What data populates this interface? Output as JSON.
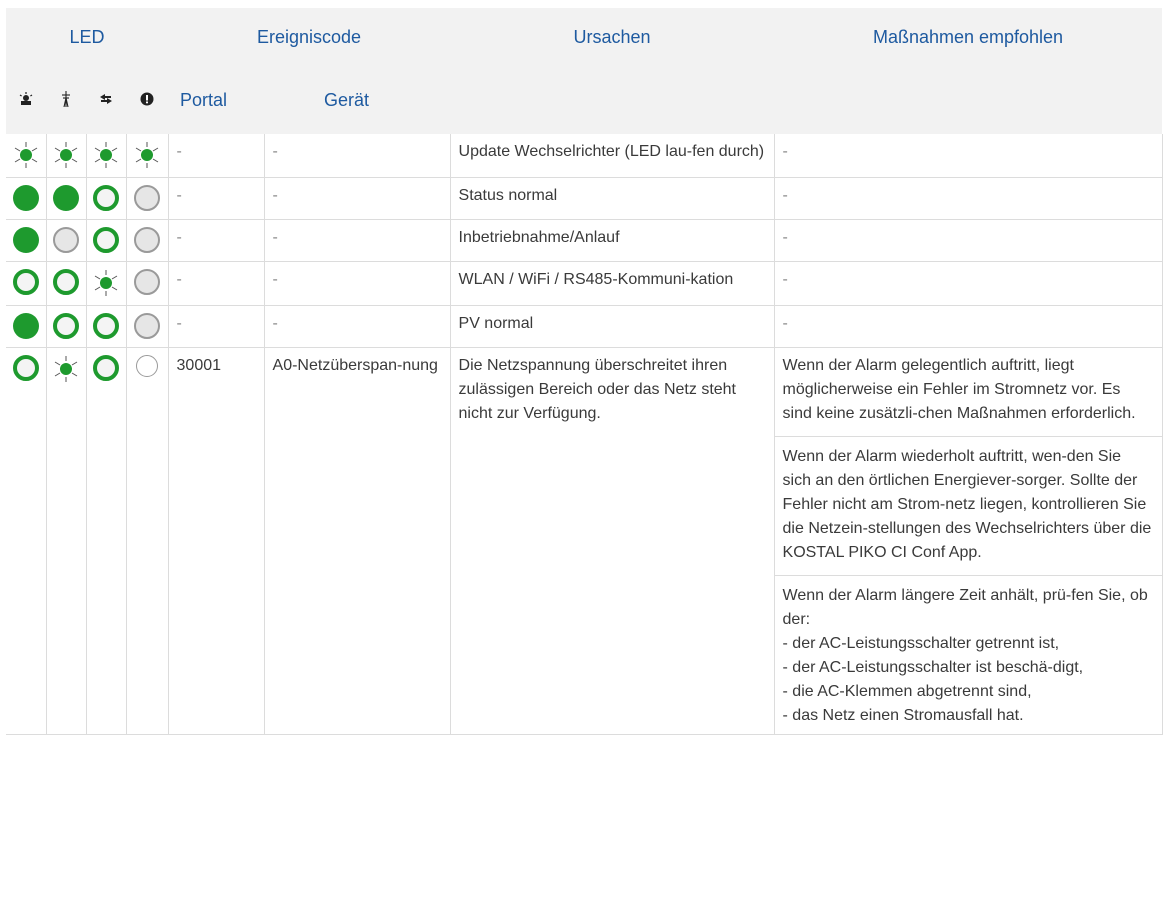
{
  "header": {
    "led": "LED",
    "ereigniscode": "Ereigniscode",
    "ursachen": "Ursachen",
    "massnahmen": "Maßnahmen empfohlen",
    "portal": "Portal",
    "geraet": "Gerät",
    "led_icons": [
      "pv-sun-icon",
      "grid-pylon-icon",
      "communication-icon",
      "warning-icon"
    ]
  },
  "rows": [
    {
      "leds": [
        "blink",
        "blink",
        "blink",
        "blink"
      ],
      "portal": "-",
      "geraet": "-",
      "ursache": "Update Wechselrichter (LED lau-fen durch)",
      "massnahmen": [
        "-"
      ]
    },
    {
      "leds": [
        "on",
        "on",
        "ring",
        "off"
      ],
      "portal": "-",
      "geraet": "-",
      "ursache": "Status normal",
      "massnahmen": [
        "-"
      ]
    },
    {
      "leds": [
        "on",
        "off",
        "ring",
        "off"
      ],
      "portal": "-",
      "geraet": "-",
      "ursache": "Inbetriebnahme/Anlauf",
      "massnahmen": [
        "-"
      ]
    },
    {
      "leds": [
        "ring",
        "ring",
        "blink",
        "off"
      ],
      "portal": "-",
      "geraet": "-",
      "ursache": "WLAN / WiFi / RS485-Kommuni-kation",
      "massnahmen": [
        "-"
      ]
    },
    {
      "leds": [
        "on",
        "ring",
        "ring",
        "off"
      ],
      "portal": "-",
      "geraet": "-",
      "ursache": "PV normal",
      "massnahmen": [
        "-"
      ]
    },
    {
      "leds": [
        "ring",
        "blink",
        "ring",
        "offw"
      ],
      "portal": "30001",
      "geraet": "A0-Netzüberspan-nung",
      "ursache": "Die Netzspannung überschreitet ihren zulässigen Bereich oder das Netz steht nicht zur Verfügung.",
      "massnahmen": [
        "Wenn der Alarm gelegentlich auftritt, liegt möglicherweise ein Fehler im Stromnetz vor. Es sind keine zusätzli-chen Maßnahmen erforderlich.",
        "Wenn der Alarm wiederholt auftritt, wen-den Sie sich an den örtlichen Energiever-sorger. Sollte der Fehler nicht am Strom-netz liegen, kontrollieren Sie die Netzein-stellungen des Wechselrichters über die KOSTAL PIKO CI Conf App.",
        "Wenn der Alarm längere Zeit anhält, prü-fen Sie, ob der:\n- der AC-Leistungsschalter getrennt ist,\n- der AC-Leistungsschalter ist beschä-digt,\n- die AC-Klemmen abgetrennt sind,\n- das Netz einen Stromausfall hat."
      ]
    }
  ],
  "colors": {
    "header_text": "#1e5aa0",
    "led_green": "#1e9a2e",
    "header_bg": "#f2f2f2"
  }
}
